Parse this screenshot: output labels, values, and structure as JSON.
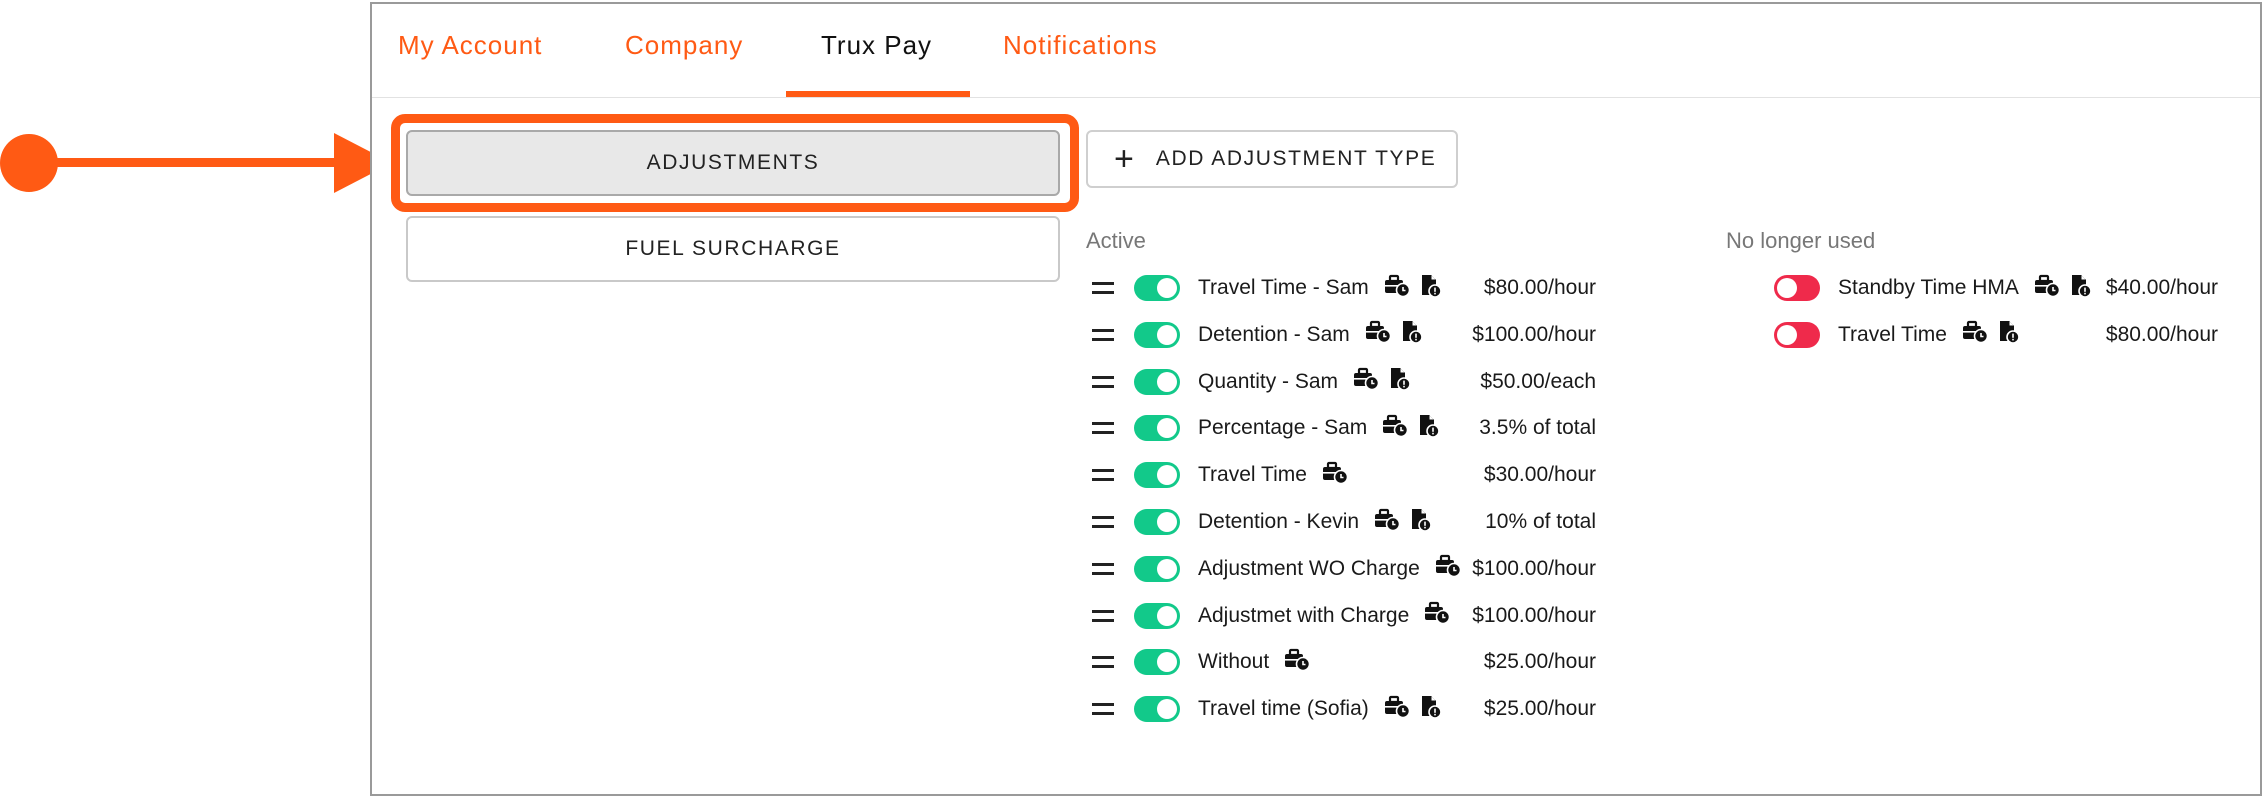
{
  "tabs": [
    {
      "label": "My Account"
    },
    {
      "label": "Company"
    },
    {
      "label": "Trux Pay"
    },
    {
      "label": "Notifications"
    }
  ],
  "active_tab": "Trux Pay",
  "nav": {
    "adjustments": "ADJUSTMENTS",
    "fuel_surcharge": "FUEL SURCHARGE",
    "selected": "ADJUSTMENTS"
  },
  "add_button": {
    "label": "ADD ADJUSTMENT TYPE",
    "icon": "plus-icon"
  },
  "active": {
    "title": "Active",
    "items": [
      {
        "name": "Travel Time - Sam",
        "price": "$80.00/hour",
        "enabled": true,
        "icons": [
          "briefcase-clock-icon",
          "document-info-icon"
        ]
      },
      {
        "name": "Detention - Sam",
        "price": "$100.00/hour",
        "enabled": true,
        "icons": [
          "briefcase-clock-icon",
          "document-info-icon"
        ]
      },
      {
        "name": "Quantity - Sam",
        "price": "$50.00/each",
        "enabled": true,
        "icons": [
          "briefcase-clock-icon",
          "document-info-icon"
        ]
      },
      {
        "name": "Percentage - Sam",
        "price": "3.5% of total",
        "enabled": true,
        "icons": [
          "briefcase-clock-icon",
          "document-info-icon"
        ]
      },
      {
        "name": "Travel Time",
        "price": "$30.00/hour",
        "enabled": true,
        "icons": [
          "briefcase-clock-icon"
        ]
      },
      {
        "name": "Detention - Kevin",
        "price": "10% of total",
        "enabled": true,
        "icons": [
          "briefcase-clock-icon",
          "document-info-icon"
        ]
      },
      {
        "name": "Adjustment WO Charge",
        "price": "$100.00/hour",
        "enabled": true,
        "icons": [
          "briefcase-clock-icon"
        ]
      },
      {
        "name": "Adjustmet with Charge",
        "price": "$100.00/hour",
        "enabled": true,
        "icons": [
          "briefcase-clock-icon"
        ]
      },
      {
        "name": "Without",
        "price": "$25.00/hour",
        "enabled": true,
        "icons": [
          "briefcase-clock-icon"
        ]
      },
      {
        "name": "Travel time (Sofia)",
        "price": "$25.00/hour",
        "enabled": true,
        "icons": [
          "briefcase-clock-icon",
          "document-info-icon"
        ]
      }
    ]
  },
  "inactive": {
    "title": "No longer used",
    "items": [
      {
        "name": "Standby Time HMA",
        "price": "$40.00/hour",
        "enabled": false,
        "icons": [
          "briefcase-clock-icon",
          "document-info-icon"
        ]
      },
      {
        "name": "Travel Time",
        "price": "$80.00/hour",
        "enabled": false,
        "icons": [
          "briefcase-clock-icon",
          "document-info-icon"
        ]
      }
    ]
  },
  "colors": {
    "accent": "#ff5a14",
    "toggle_on": "#12c98a",
    "toggle_off": "#ef2a4b",
    "selected_button_bg": "#e8e8e8"
  }
}
